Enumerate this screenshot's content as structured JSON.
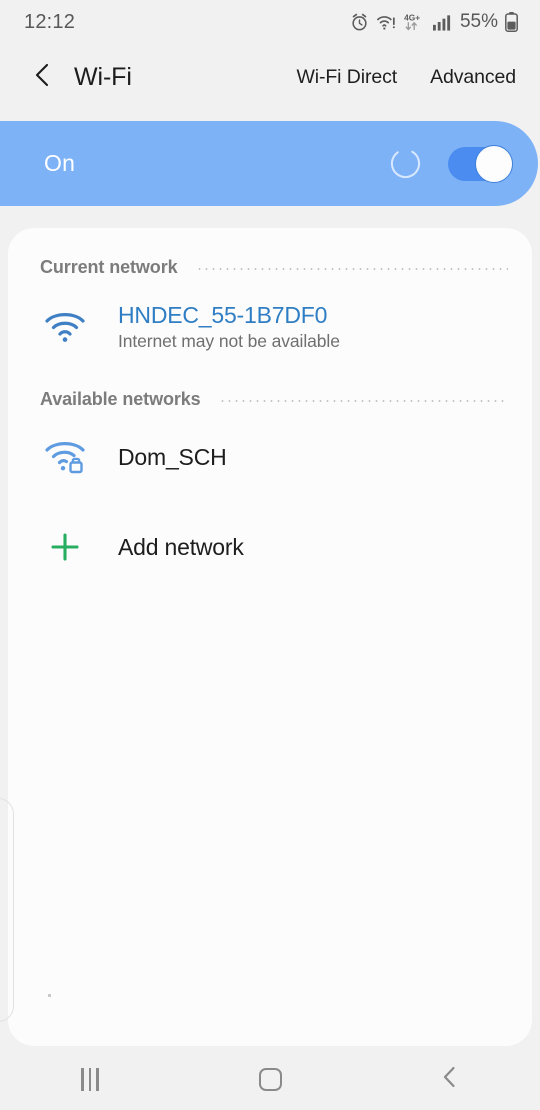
{
  "status_bar": {
    "time": "12:12",
    "battery_percent": "55%",
    "network_type": "4G+",
    "icons": [
      "alarm-icon",
      "wifi-warning-icon",
      "mobile-data-icon",
      "signal-bars-icon",
      "battery-icon"
    ]
  },
  "app_bar": {
    "back_label": "back-icon",
    "title": "Wi-Fi",
    "actions": [
      {
        "label": "Wi-Fi Direct"
      },
      {
        "label": "Advanced"
      }
    ]
  },
  "toggle_banner": {
    "state_label": "On",
    "scanning": true,
    "switch_on": true,
    "background_color": "#7eb2f7",
    "switch_track_color": "#4a8cf0"
  },
  "sections": [
    {
      "key": "current",
      "title": "Current network",
      "rows": [
        {
          "name": "HNDEC_55-1B7DF0",
          "subtitle": "Internet may not be available",
          "icon": "wifi-connected-icon",
          "secured": false,
          "connected": true
        }
      ]
    },
    {
      "key": "available",
      "title": "Available networks",
      "rows": [
        {
          "name": "Dom_SCH",
          "subtitle": "",
          "icon": "wifi-locked-icon",
          "secured": true,
          "connected": false
        },
        {
          "name": "Add network",
          "subtitle": "",
          "icon": "plus-icon",
          "secured": false,
          "connected": false
        }
      ]
    }
  ],
  "colors": {
    "accent_blue": "#2f7ec4",
    "banner_blue": "#7eb2f7",
    "add_green": "#27ae60",
    "page_background": "#f1f1f1",
    "card_background": "#fcfcfc"
  },
  "nav_bar": {
    "recents_label": "recents-icon",
    "home_label": "home-icon",
    "back_label": "back-icon"
  }
}
